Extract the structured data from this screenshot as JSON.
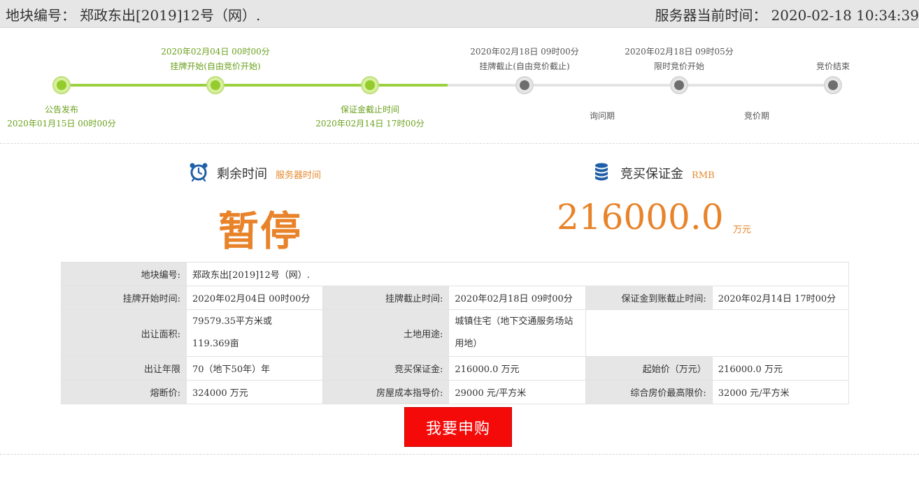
{
  "header": {
    "parcel_label": "地块编号：",
    "parcel_value": "郑政东出[2019]12号（网）.",
    "server_time_label": "服务器当前时间：",
    "server_time_value": "2020-02-18  10:34:39"
  },
  "timeline": {
    "milestones": [
      {
        "top": "",
        "name_above": "",
        "name_below": "公告发布",
        "date_below": "2020年01月15日 00时00分",
        "status": "done"
      },
      {
        "top": "2020年02月04日 00时00分",
        "name_above": "挂牌开始(自由竞价开始)",
        "name_below": "",
        "date_below": "",
        "status": "done"
      },
      {
        "top": "",
        "name_above": "",
        "name_below": "保证金截止时间",
        "date_below": "2020年02月14日 17时00分",
        "status": "done"
      },
      {
        "top": "2020年02月18日 09时00分",
        "name_above": "挂牌截止(自由竞价截止)",
        "name_below": "",
        "date_below": "",
        "status": "pending"
      },
      {
        "top": "2020年02月18日 09时05分",
        "name_above": "限时竞价开始",
        "name_below": "",
        "date_below": "",
        "status": "pending"
      },
      {
        "top": "",
        "name_above": "竞价结束",
        "name_below": "",
        "date_below": "",
        "status": "pending"
      }
    ],
    "phases": [
      "询问期",
      "竞价期"
    ]
  },
  "remaining": {
    "title": "剩余时间",
    "sub": "服务器时间",
    "status": "暂停"
  },
  "deposit": {
    "title": "竞买保证金",
    "sub": "RMB",
    "amount": "216000.0",
    "unit": "万元"
  },
  "details": {
    "parcel_no": {
      "label": "地块编号:",
      "value": "郑政东出[2019]12号（网）."
    },
    "listing_start": {
      "label": "挂牌开始时间:",
      "value": "2020年02月04日 00时00分"
    },
    "listing_end": {
      "label": "挂牌截止时间:",
      "value": "2020年02月18日 09时00分"
    },
    "deposit_deadline": {
      "label": "保证金到账截止时间:",
      "value": "2020年02月14日 17时00分"
    },
    "area": {
      "label": "出让面积:",
      "value_line1": "79579.35平方米或",
      "value_line2": "119.369亩"
    },
    "land_use": {
      "label": "土地用途:",
      "value_line1": "城镇住宅（地下交通服务场站",
      "value_line2": "用地）"
    },
    "term": {
      "label": "出让年限",
      "value": "70（地下50年）年"
    },
    "bid_deposit": {
      "label": "竞买保证金:",
      "value": "216000.0 万元"
    },
    "start_price": {
      "label": "起始价（万元）",
      "value": "216000.0 万元"
    },
    "circuit_price": {
      "label": "熔断价:",
      "value": "324000 万元"
    },
    "cost_guide": {
      "label": "房屋成本指导价:",
      "value": "29000 元/平方米"
    },
    "max_price": {
      "label": "综合房价最高限价:",
      "value": "32000 元/平方米"
    }
  },
  "actions": {
    "apply_label": "我要申购"
  },
  "colors": {
    "accent_orange": "#e8832a",
    "progress_green": "#9bd141",
    "button_red": "#f50a0a"
  }
}
